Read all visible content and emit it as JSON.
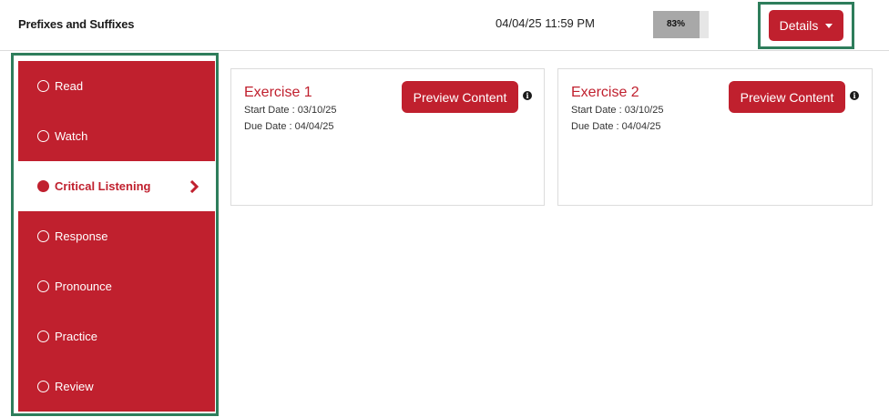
{
  "header": {
    "title": "Prefixes and Suffixes",
    "datetime": "04/04/25 11:59 PM",
    "progress_label": "83%",
    "progress_value": 0.83,
    "details_label": "Details"
  },
  "sidebar": {
    "items": [
      {
        "label": "Read",
        "active": false,
        "icon": "radio-empty-icon"
      },
      {
        "label": "Watch",
        "active": false,
        "icon": "radio-empty-icon"
      },
      {
        "label": "Critical Listening",
        "active": true,
        "icon": "radio-filled-icon"
      },
      {
        "label": "Response",
        "active": false,
        "icon": "radio-empty-icon"
      },
      {
        "label": "Pronounce",
        "active": false,
        "icon": "radio-empty-icon"
      },
      {
        "label": "Practice",
        "active": false,
        "icon": "radio-empty-icon"
      },
      {
        "label": "Review",
        "active": false,
        "icon": "radio-empty-icon"
      }
    ]
  },
  "exercises": [
    {
      "title": "Exercise 1",
      "start": "Start Date : 03/10/25",
      "due": "Due Date : 04/04/25",
      "button": "Preview Content",
      "info": "i"
    },
    {
      "title": "Exercise 2",
      "start": "Start Date : 03/10/25",
      "due": "Due Date : 04/04/25",
      "button": "Preview Content",
      "info": "i"
    }
  ],
  "colors": {
    "accent": "#c0202e",
    "highlight_frame": "#2e7d5b",
    "progress_fill": "#a8a8a8"
  }
}
